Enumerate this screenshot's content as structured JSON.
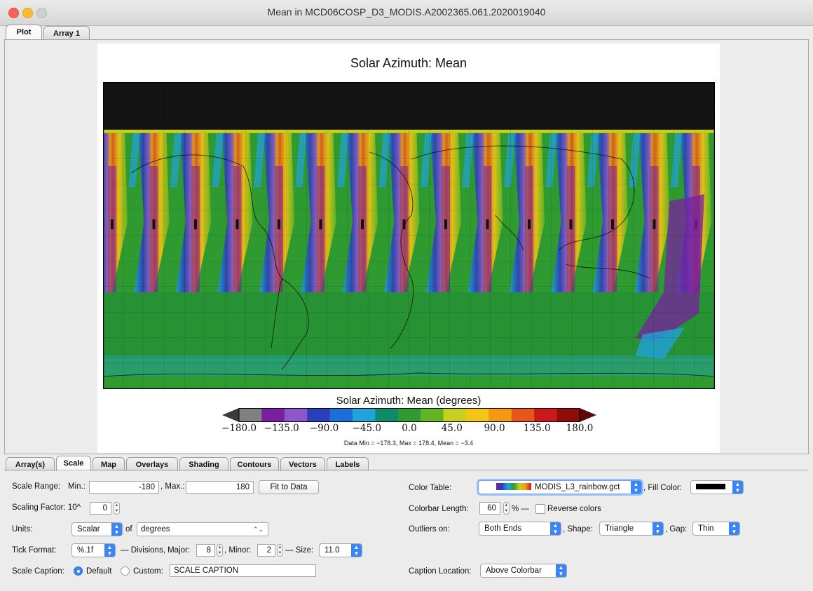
{
  "window": {
    "title": "Mean in MCD06COSP_D3_MODIS.A2002365.061.2020019040"
  },
  "top_tabs": [
    "Plot",
    "Array 1"
  ],
  "plot": {
    "title": "Solar Azimuth: Mean",
    "colorbar_title": "Solar Azimuth: Mean (degrees)",
    "colorbar_ticks": [
      "−180.0",
      "−135.0",
      "−90.0",
      "−45.0",
      "0.0",
      "45.0",
      "90.0",
      "135.0",
      "180.0"
    ],
    "colorbar_colors": [
      "#808080",
      "#7a1fa2",
      "#8f55cc",
      "#2b3fb8",
      "#1b6fd6",
      "#20a3dc",
      "#0e8c6a",
      "#2f9a2f",
      "#62b522",
      "#c7cf20",
      "#f5c514",
      "#f39a12",
      "#e9561c",
      "#c81a1a",
      "#8e0c0c"
    ],
    "outlier_low_color": "#3a3a3a",
    "outlier_high_color": "#5a0a0a",
    "stats": "Data Min = −178.3, Max = 178.4, Mean = −3.4"
  },
  "bottom_tabs": [
    "Array(s)",
    "Scale",
    "Map",
    "Overlays",
    "Shading",
    "Contours",
    "Vectors",
    "Labels"
  ],
  "scale": {
    "range_label": "Scale Range:",
    "min_label": "Min.:",
    "min_value": "-180",
    "max_label": ", Max.:",
    "max_value": "180",
    "fit_button": "Fit to Data",
    "factor_label": "Scaling Factor: 10^",
    "factor_value": "0",
    "units_label": "Units:",
    "units_type": "Scalar",
    "of_label": "of",
    "units_value": "degrees",
    "tick_label": "Tick Format:",
    "tick_format": "%.1f",
    "divisions_label": "— Divisions, Major:",
    "major_value": "8",
    "minor_label": ", Minor:",
    "minor_value": "2",
    "size_label": "— Size:",
    "size_value": "11.0",
    "caption_label": "Scale Caption:",
    "caption_default": "Default",
    "caption_custom": "Custom:",
    "caption_custom_value": "SCALE CAPTION"
  },
  "color": {
    "table_label": "Color Table:",
    "table_value": "MODIS_L3_rainbow.gct",
    "fill_label": ", Fill Color:",
    "fill_color": "#000000",
    "length_label": "Colorbar Length:",
    "length_value": "60",
    "length_unit": "% —",
    "reverse_label": "Reverse colors",
    "outliers_label": "Outliers on:",
    "outliers_value": "Both Ends",
    "shape_label": ", Shape:",
    "shape_value": "Triangle",
    "gap_label": ", Gap:",
    "gap_value": "Thin",
    "caption_loc_label": "Caption Location:",
    "caption_loc_value": "Above Colorbar"
  }
}
